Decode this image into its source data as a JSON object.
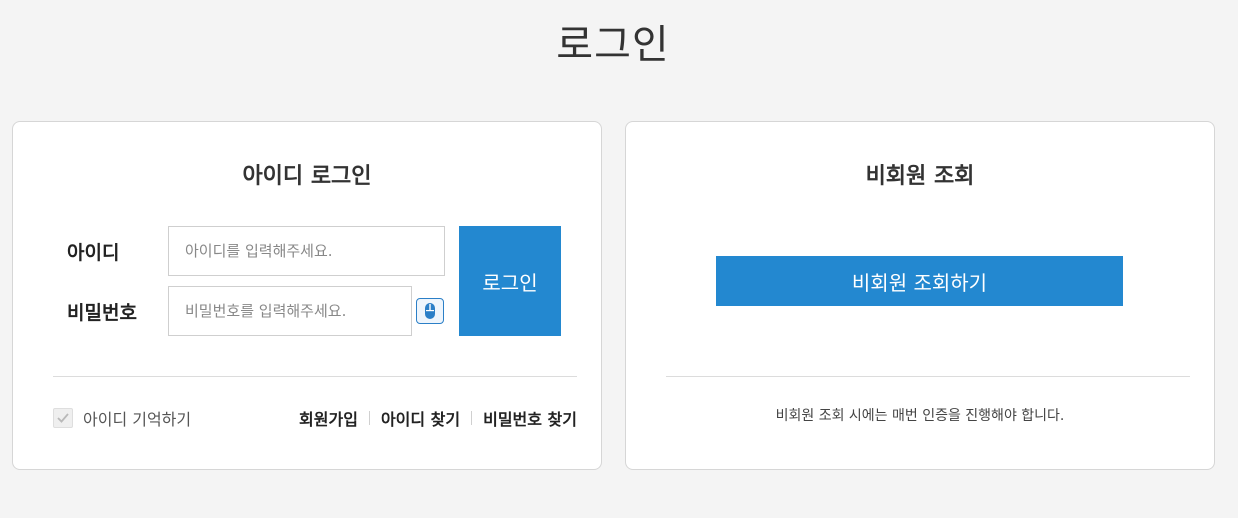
{
  "page": {
    "title": "로그인"
  },
  "id_login": {
    "title": "아이디 로그인",
    "id_label": "아이디",
    "id_placeholder": "아이디를 입력해주세요.",
    "pw_label": "비밀번호",
    "pw_placeholder": "비밀번호를 입력해주세요.",
    "login_button": "로그인",
    "remember_label": "아이디 기억하기",
    "remember_checked": false,
    "links": [
      "회원가입",
      "아이디 찾기",
      "비밀번호 찾기"
    ]
  },
  "guest": {
    "title": "비회원 조회",
    "button": "비회원 조회하기",
    "note": "비회원 조회 시에는 매번 인증을 진행해야 합니다."
  },
  "icons": {
    "keyboard_toggle": "mouse-icon",
    "remember_check": "check-icon"
  },
  "colors": {
    "accent": "#2388d0",
    "background": "#f4f4f4"
  }
}
